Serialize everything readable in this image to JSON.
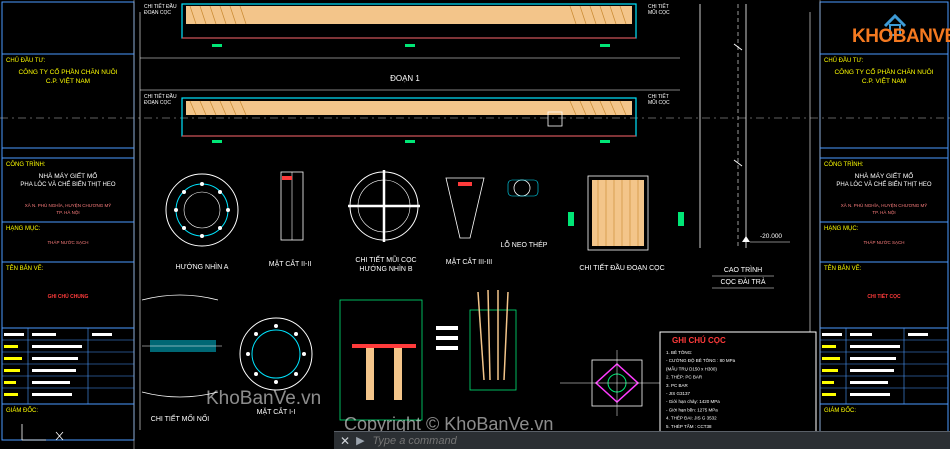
{
  "left_panel": {
    "owner_heading": "CHỦ ĐẦU TƯ:",
    "owner_line1": "CÔNG TY CỔ PHẦN CHĂN NUÔI",
    "owner_line2": "C.P. VIỆT NAM",
    "project_heading": "CÔNG TRÌNH:",
    "project_line1": "NHÀ MÁY GIẾT MỔ",
    "project_line2": "PHA LÓC VÀ CHẾ BIẾN THỊT HEO",
    "location_line": "XÃ N. PHÚ NGHĨA, HUYỆN CHƯƠNG MỸ",
    "location_city": "TP. HÀ NỘI",
    "item_heading": "HẠNG MỤC:",
    "item_value": "THÁP NƯỚC SẠCH",
    "drawing_heading": "TÊN BẢN VẼ:",
    "drawing_value": "GHI CHÚ CHUNG",
    "manager_heading": "GIÁM ĐỐC:"
  },
  "right_panel": {
    "owner_heading": "CHỦ ĐẦU TƯ:",
    "owner_line1": "CÔNG TY CỔ PHẦN CHĂN NUÔI",
    "owner_line2": "C.P. VIỆT NAM",
    "project_heading": "CÔNG TRÌNH:",
    "project_line1": "NHÀ MÁY GIẾT MỔ",
    "project_line2": "PHA LÓC VÀ CHẾ BIẾN THỊT HEO",
    "location_line": "XÃ N. PHÚ NGHĨA, HUYỆN CHƯƠNG MỸ",
    "location_city": "TP. HÀ NỘI",
    "item_heading": "HẠNG MỤC:",
    "item_value": "THÁP NƯỚC SẠCH",
    "drawing_heading": "TÊN BẢN VẼ:",
    "drawing_value": "CHI TIẾT CỌC",
    "manager_heading": "GIÁM ĐỐC:"
  },
  "drawing": {
    "pile_label_head_top": "CHI TIẾT ĐẦU\nĐOẠN CỌC",
    "pile_label_tip_top": "CHI TIẾT\nMŨI CỌC",
    "segment_label": "ĐOẠN 1",
    "pile_label_head_bottom": "CHI TIẾT ĐẦU\nĐOẠN CỌC",
    "pile_label_tip_bottom": "CHI TIẾT\nMŨI CỌC",
    "view_a": "HƯỚNG NHÌN A",
    "section_2": "MẶT CẮT II-II",
    "tip_detail": "CHI TIẾT MŨI CỌC",
    "view_b": "HƯỚNG NHÌN B",
    "section_3": "MẶT CẮT III-III",
    "anchor_hole": "LỖ NEO THÉP",
    "head_detail": "CHI TIẾT ĐẦU ĐOẠN CỌC",
    "elevation_title": "CAO TRÌNH",
    "elevation_sub": "CỌC ĐÀI TRẢ",
    "elevation_value": "-20.000",
    "joint_detail": "CHI TIẾT MỐI NỐI",
    "section_1": "MẶT CẮT I-I",
    "notes_title": "GHI CHÚ CỌC",
    "notes": [
      "1. BÊ TÔNG:",
      "- CƯỜNG ĐỘ BÊ TÔNG : 80 MPa",
      "(MẪU TRỤ D150 x H300)",
      "2. THÉP: PC BAR",
      "3. PC BAR",
      "- JIS G3137",
      "- Giới hạn chảy: 1420 MPa",
      "- Giới hạn bền: 1275 MPa",
      "4. THÉP ĐAI: JIS G 3532",
      "5. THÉP TẤM : CCT38",
      "6. TẤT CẢ THÉP TẤM PHẢI TUÂN THỦ THEO TCVN 5575:2012"
    ]
  },
  "logo": {
    "name": "KHOBANVE",
    "icon": "house-icon"
  },
  "watermarks": [
    "KhoBanVe.vn",
    "Copyright © KhoBanVe.vn"
  ],
  "command_line": {
    "close_label": "✕",
    "prompt_symbol": "▶",
    "placeholder": "Type a command"
  }
}
